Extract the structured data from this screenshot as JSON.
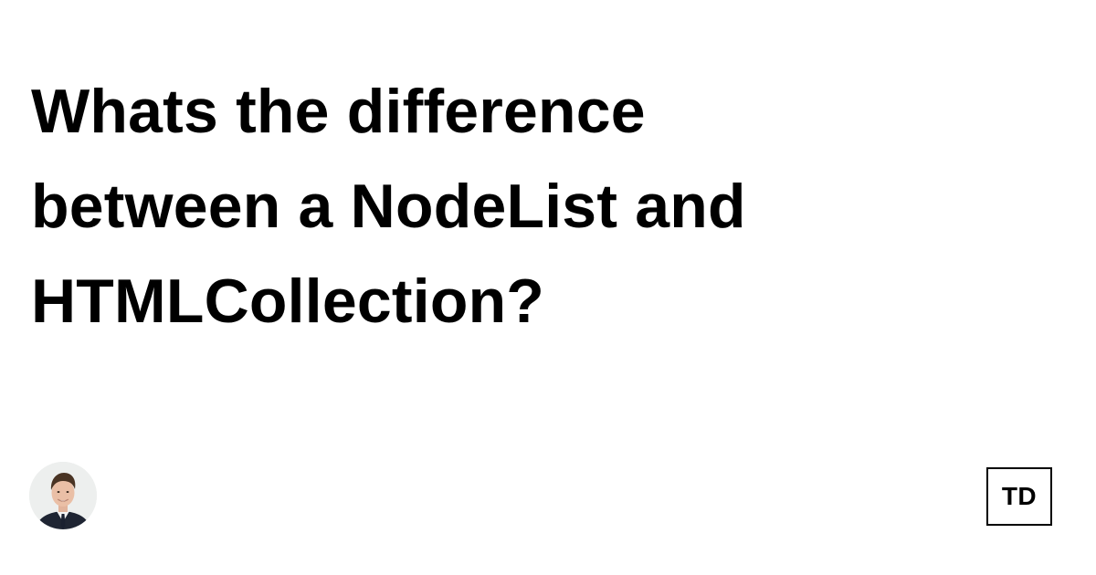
{
  "post": {
    "title": "Whats the difference between a NodeList and HTMLCollection?"
  },
  "author": {
    "avatar_icon": "author-avatar-photo"
  },
  "brand": {
    "logo_text": "TD"
  }
}
